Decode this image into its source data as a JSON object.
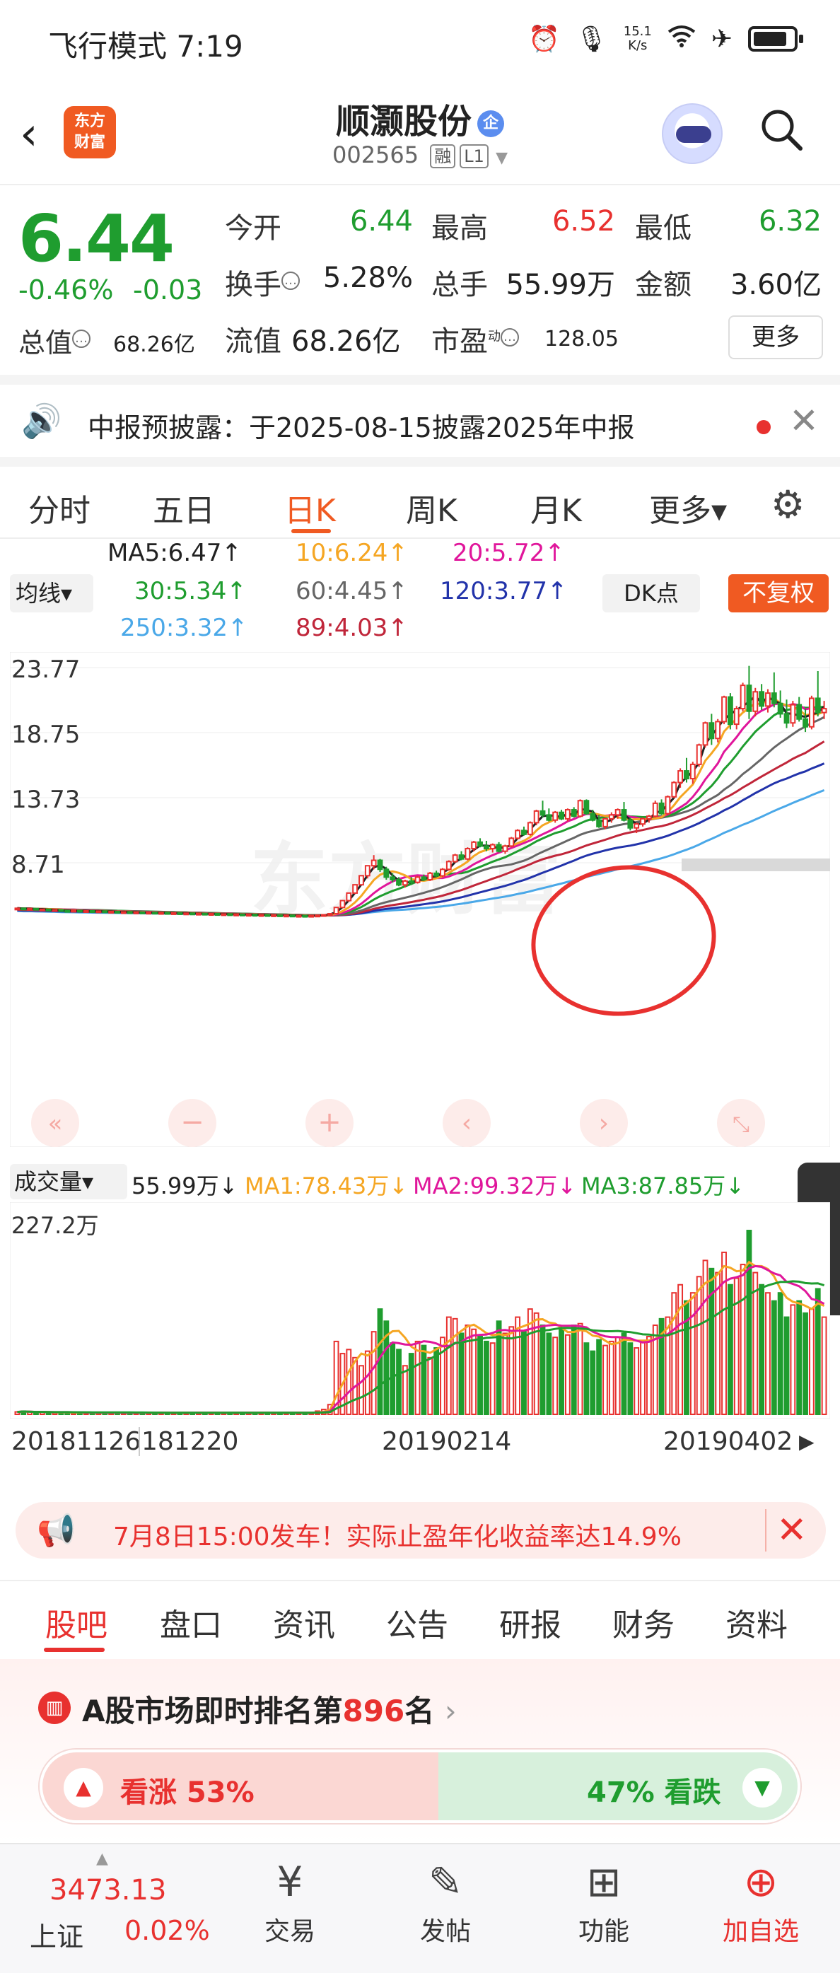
{
  "status_bar": {
    "time": "飞行模式 7:19",
    "net_speed": "15.1\nK/s",
    "icons": [
      "alarm-icon",
      "mic-icon",
      "wifi-icon",
      "airplane-icon",
      "battery-icon"
    ]
  },
  "header": {
    "logo_text": "东方\n财富",
    "stock_name": "顺灏股份",
    "badge": "企",
    "stock_code": "002565",
    "tag_rong": "融",
    "tag_level": "L1"
  },
  "quote": {
    "price": "6.44",
    "pct": "-0.46%",
    "change": "-0.03",
    "open_label": "今开",
    "open": "6.44",
    "high_label": "最高",
    "high": "6.52",
    "low_label": "最低",
    "low": "6.32",
    "turnover_label": "换手",
    "turnover": "5.28%",
    "volume_label": "总手",
    "volume": "55.99万",
    "amount_label": "金额",
    "amount": "3.60亿",
    "total_mv_label": "总值",
    "total_mv": "68.26亿",
    "float_mv_label": "流值",
    "float_mv": "68.26亿",
    "pe_label": "市盈",
    "pe_sup": "动",
    "pe": "128.05",
    "more_label": "更多"
  },
  "notice": {
    "text": "中报预披露：于2025-08-15披露2025年中报"
  },
  "period_tabs": [
    "分时",
    "五日",
    "日K",
    "周K",
    "月K",
    "更多▾"
  ],
  "active_period": "日K",
  "ma_legend": {
    "selector": "均线▾",
    "ma5": "MA5:6.47↑",
    "ma10": "10:6.24↑",
    "ma20": "20:5.72↑",
    "ma30": "30:5.34↑",
    "ma60": "60:4.45↑",
    "ma120": "120:3.77↑",
    "ma250": "250:3.32↑",
    "ma89": "89:4.03↑",
    "dk_label": "DK点",
    "adjust_label": "不复权",
    "colors": {
      "ma5": "#222222",
      "ma10": "#f5a623",
      "ma20": "#e0169b",
      "ma30": "#1f9d2f",
      "ma60": "#666666",
      "ma120": "#2233aa",
      "ma250": "#4aa8e8",
      "ma89": "#c0263a"
    }
  },
  "chart_data": {
    "type": "candlestick",
    "y_axis_labels": [
      "23.77",
      "18.75",
      "13.73",
      "8.71"
    ],
    "watermark": "东方财富",
    "x_labels": [
      "20181126",
      "181220",
      "20190214",
      "20190402"
    ],
    "volume_max_label": "227.2万",
    "up_color": "#e8312f",
    "down_color": "#1f9d2f",
    "candles": [
      [
        5.2,
        5.25,
        5.15,
        5.2
      ],
      [
        5.2,
        5.22,
        5.12,
        5.15
      ],
      [
        5.15,
        5.2,
        5.1,
        5.18
      ],
      [
        5.18,
        5.2,
        5.08,
        5.1
      ],
      [
        5.1,
        5.15,
        5.05,
        5.12
      ],
      [
        5.12,
        5.14,
        5.0,
        5.05
      ],
      [
        5.05,
        5.1,
        5.0,
        5.08
      ],
      [
        5.08,
        5.1,
        4.98,
        5.02
      ],
      [
        5.02,
        5.06,
        4.96,
        5.0
      ],
      [
        5.0,
        5.05,
        4.95,
        5.03
      ],
      [
        5.03,
        5.05,
        4.95,
        4.98
      ],
      [
        4.98,
        5.02,
        4.92,
        5.0
      ],
      [
        5.0,
        5.02,
        4.92,
        4.95
      ],
      [
        4.95,
        5.0,
        4.9,
        4.98
      ],
      [
        4.98,
        5.0,
        4.9,
        4.93
      ],
      [
        4.93,
        4.98,
        4.88,
        4.95
      ],
      [
        4.95,
        4.97,
        4.88,
        4.9
      ],
      [
        4.9,
        4.95,
        4.86,
        4.92
      ],
      [
        4.92,
        4.95,
        4.85,
        4.88
      ],
      [
        4.88,
        4.92,
        4.84,
        4.9
      ],
      [
        4.9,
        4.92,
        4.82,
        4.86
      ],
      [
        4.86,
        4.9,
        4.8,
        4.88
      ],
      [
        4.88,
        4.9,
        4.8,
        4.84
      ],
      [
        4.84,
        4.88,
        4.78,
        4.86
      ],
      [
        4.86,
        4.88,
        4.78,
        4.82
      ],
      [
        4.82,
        4.86,
        4.76,
        4.84
      ],
      [
        4.84,
        4.86,
        4.76,
        4.8
      ],
      [
        4.8,
        4.84,
        4.74,
        4.82
      ],
      [
        4.82,
        4.84,
        4.74,
        4.78
      ],
      [
        4.78,
        4.82,
        4.72,
        4.8
      ],
      [
        4.8,
        4.82,
        4.72,
        4.76
      ],
      [
        4.76,
        4.8,
        4.7,
        4.78
      ],
      [
        4.78,
        4.8,
        4.7,
        4.74
      ],
      [
        4.74,
        4.78,
        4.68,
        4.76
      ],
      [
        4.76,
        4.78,
        4.68,
        4.72
      ],
      [
        4.72,
        4.76,
        4.66,
        4.74
      ],
      [
        4.74,
        4.76,
        4.66,
        4.7
      ],
      [
        4.7,
        4.74,
        4.64,
        4.72
      ],
      [
        4.72,
        4.74,
        4.64,
        4.68
      ],
      [
        4.68,
        4.72,
        4.62,
        4.7
      ],
      [
        4.7,
        4.72,
        4.62,
        4.66
      ],
      [
        4.66,
        4.7,
        4.6,
        4.68
      ],
      [
        4.68,
        4.7,
        4.6,
        4.64
      ],
      [
        4.64,
        4.68,
        4.58,
        4.66
      ],
      [
        4.66,
        4.68,
        4.58,
        4.62
      ],
      [
        4.62,
        4.66,
        4.56,
        4.64
      ],
      [
        4.64,
        4.66,
        4.56,
        4.6
      ],
      [
        4.6,
        4.66,
        4.56,
        4.64
      ],
      [
        4.64,
        4.7,
        4.6,
        4.66
      ],
      [
        4.66,
        4.72,
        4.62,
        4.7
      ],
      [
        4.7,
        4.8,
        4.66,
        4.78
      ],
      [
        4.78,
        5.3,
        4.76,
        5.26
      ],
      [
        5.26,
        5.79,
        5.2,
        5.79
      ],
      [
        5.79,
        6.37,
        5.7,
        6.37
      ],
      [
        6.37,
        7.01,
        6.3,
        7.01
      ],
      [
        7.01,
        7.71,
        6.95,
        7.71
      ],
      [
        7.71,
        8.48,
        7.5,
        8.48
      ],
      [
        8.48,
        9.3,
        8.2,
        8.9
      ],
      [
        8.9,
        9.0,
        8.0,
        8.2
      ],
      [
        8.2,
        8.4,
        7.4,
        7.6
      ],
      [
        7.6,
        7.9,
        7.2,
        7.4
      ],
      [
        7.4,
        7.6,
        6.9,
        7.0
      ],
      [
        7.0,
        7.4,
        6.8,
        7.3
      ],
      [
        7.3,
        7.6,
        7.0,
        7.2
      ],
      [
        7.2,
        7.7,
        7.1,
        7.6
      ],
      [
        7.6,
        7.8,
        7.3,
        7.4
      ],
      [
        7.4,
        8.0,
        7.3,
        7.9
      ],
      [
        7.9,
        8.1,
        7.6,
        7.7
      ],
      [
        7.7,
        8.3,
        7.6,
        8.2
      ],
      [
        8.2,
        8.9,
        8.1,
        8.8
      ],
      [
        8.8,
        9.4,
        8.7,
        9.3
      ],
      [
        9.3,
        9.6,
        8.9,
        9.0
      ],
      [
        9.0,
        9.9,
        8.9,
        9.8
      ],
      [
        9.8,
        10.4,
        9.6,
        10.3
      ],
      [
        10.3,
        10.6,
        9.9,
        10.0
      ],
      [
        10.0,
        10.4,
        9.6,
        9.8
      ],
      [
        9.8,
        10.2,
        9.5,
        10.1
      ],
      [
        10.1,
        10.3,
        9.5,
        9.6
      ],
      [
        9.6,
        10.1,
        9.4,
        10.0
      ],
      [
        10.0,
        10.7,
        9.9,
        10.6
      ],
      [
        10.6,
        11.3,
        10.5,
        11.2
      ],
      [
        11.2,
        11.5,
        10.8,
        10.9
      ],
      [
        10.9,
        11.9,
        10.8,
        11.8
      ],
      [
        11.8,
        12.8,
        11.6,
        12.7
      ],
      [
        12.7,
        13.5,
        12.2,
        12.4
      ],
      [
        12.4,
        12.9,
        11.9,
        12.0
      ],
      [
        12.0,
        12.7,
        11.8,
        12.6
      ],
      [
        12.6,
        12.8,
        12.0,
        12.1
      ],
      [
        12.1,
        12.9,
        11.9,
        12.8
      ],
      [
        12.8,
        13.0,
        12.2,
        12.3
      ],
      [
        12.3,
        13.6,
        12.2,
        13.5
      ],
      [
        13.5,
        13.6,
        12.4,
        12.5
      ],
      [
        12.5,
        12.8,
        11.9,
        12.0
      ],
      [
        12.0,
        12.4,
        11.4,
        11.5
      ],
      [
        11.5,
        12.2,
        11.3,
        12.1
      ],
      [
        12.1,
        12.6,
        11.8,
        12.4
      ],
      [
        12.4,
        12.9,
        12.1,
        12.8
      ],
      [
        12.8,
        13.4,
        11.9,
        12.0
      ],
      [
        12.0,
        12.2,
        11.2,
        11.4
      ],
      [
        11.4,
        11.8,
        11.0,
        11.7
      ],
      [
        11.7,
        12.2,
        11.5,
        12.1
      ],
      [
        12.1,
        12.4,
        11.8,
        12.3
      ],
      [
        12.3,
        13.5,
        12.2,
        13.3
      ],
      [
        13.3,
        13.6,
        12.4,
        12.5
      ],
      [
        12.5,
        13.9,
        12.4,
        13.8
      ],
      [
        13.8,
        15.0,
        13.7,
        14.9
      ],
      [
        14.9,
        16.0,
        14.5,
        15.8
      ],
      [
        15.8,
        16.8,
        14.9,
        15.2
      ],
      [
        15.2,
        16.5,
        14.8,
        16.3
      ],
      [
        16.3,
        17.9,
        16.1,
        17.8
      ],
      [
        17.8,
        19.6,
        17.6,
        19.5
      ],
      [
        19.5,
        20.2,
        17.8,
        18.3
      ],
      [
        18.3,
        19.8,
        18.0,
        19.6
      ],
      [
        19.6,
        21.6,
        19.4,
        21.5
      ],
      [
        21.5,
        21.8,
        19.0,
        19.4
      ],
      [
        19.4,
        20.8,
        19.0,
        20.6
      ],
      [
        20.6,
        22.6,
        20.4,
        22.4
      ],
      [
        22.4,
        23.9,
        19.8,
        20.4
      ],
      [
        20.4,
        22.2,
        20.0,
        21.9
      ],
      [
        21.9,
        22.5,
        20.5,
        20.8
      ],
      [
        20.8,
        22.1,
        20.3,
        21.8
      ],
      [
        21.8,
        23.4,
        20.7,
        21.0
      ],
      [
        21.0,
        22.0,
        19.9,
        20.2
      ],
      [
        20.2,
        21.3,
        19.1,
        19.5
      ],
      [
        19.5,
        21.2,
        19.2,
        20.9
      ],
      [
        20.9,
        21.5,
        19.6,
        19.8
      ],
      [
        19.8,
        20.6,
        18.8,
        19.2
      ],
      [
        19.2,
        21.6,
        19.0,
        21.4
      ],
      [
        21.4,
        23.5,
        20.0,
        20.3
      ],
      [
        20.3,
        21.2,
        19.8,
        20.6
      ]
    ],
    "volumes": [
      3,
      4,
      3,
      2,
      3,
      2,
      2,
      3,
      2,
      2,
      2,
      2,
      2,
      2,
      2,
      2,
      2,
      2,
      2,
      2,
      2,
      2,
      2,
      2,
      2,
      2,
      2,
      2,
      2,
      2,
      2,
      2,
      2,
      2,
      2,
      2,
      2,
      2,
      2,
      2,
      2,
      2,
      2,
      2,
      2,
      2,
      2,
      2,
      4,
      6,
      12,
      90,
      75,
      80,
      70,
      60,
      78,
      102,
      130,
      115,
      88,
      80,
      60,
      75,
      90,
      85,
      70,
      82,
      95,
      120,
      118,
      100,
      110,
      105,
      96,
      90,
      88,
      115,
      100,
      108,
      120,
      102,
      130,
      125,
      110,
      100,
      95,
      105,
      98,
      110,
      112,
      88,
      78,
      92,
      85,
      90,
      95,
      100,
      88,
      82,
      90,
      96,
      110,
      118,
      120,
      150,
      160,
      140,
      150,
      170,
      190,
      180,
      175,
      200,
      160,
      168,
      185,
      227,
      175,
      160,
      150,
      140,
      150,
      120,
      135,
      140,
      125,
      130,
      155,
      120
    ],
    "volume_legend": {
      "selector": "成交量▾",
      "vol": "55.99万↓",
      "ma1": "MA1:78.43万↓",
      "ma2": "MA2:99.32万↓",
      "ma3": "MA3:87.85万↓"
    },
    "volume_colors": {
      "ma1": "#f5a623",
      "ma2": "#e0169b",
      "ma3": "#1f9d2f"
    }
  },
  "promo": {
    "text": "7月8日15:00发车！实际止盈年化收益率达14.9%"
  },
  "bottom_tabs": [
    "股吧",
    "盘口",
    "资讯",
    "公告",
    "研报",
    "财务",
    "资料"
  ],
  "ranking": {
    "prefix": "A股市场即时排名第",
    "rank": "896",
    "suffix": "名",
    "up_label": "看涨 53%",
    "down_label": "47% 看跌"
  },
  "bottom_nav": {
    "index_value": "3473.13",
    "index_name": "上证",
    "index_pct": "0.02%",
    "items": [
      {
        "label": "交易",
        "icon": "yen-icon"
      },
      {
        "label": "发帖",
        "icon": "edit-icon"
      },
      {
        "label": "功能",
        "icon": "apps-icon"
      },
      {
        "label": "加自选",
        "icon": "add-circle-icon"
      }
    ]
  }
}
